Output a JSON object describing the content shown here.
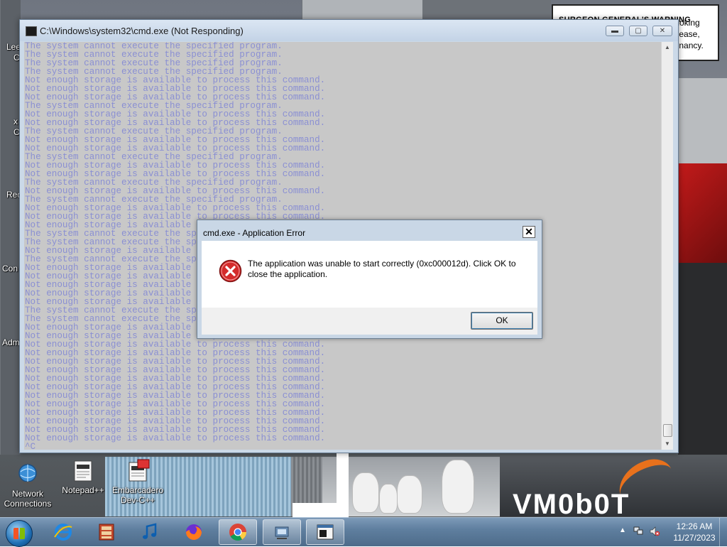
{
  "cmd_window": {
    "title": "C:\\Windows\\system32\\cmd.exe (Not Responding)",
    "min_glyph": "▬",
    "max_glyph": "▢",
    "close_glyph": "✕",
    "text_color": "#8a8fd3",
    "lines": [
      "The system cannot execute the specified program.",
      "The system cannot execute the specified program.",
      "The system cannot execute the specified program.",
      "The system cannot execute the specified program.",
      "Not enough storage is available to process this command.",
      "Not enough storage is available to process this command.",
      "Not enough storage is available to process this command.",
      "The system cannot execute the specified program.",
      "Not enough storage is available to process this command.",
      "Not enough storage is available to process this command.",
      "The system cannot execute the specified program.",
      "Not enough storage is available to process this command.",
      "Not enough storage is available to process this command.",
      "The system cannot execute the specified program.",
      "Not enough storage is available to process this command.",
      "Not enough storage is available to process this command.",
      "The system cannot execute the specified program.",
      "Not enough storage is available to process this command.",
      "The system cannot execute the specified program.",
      "Not enough storage is available to process this command.",
      "Not enough storage is available to process this command.",
      "Not enough storage is available to process this command.",
      "The system cannot execute the specified program.",
      "The system cannot execute the specified program.",
      "Not enough storage is available to process this command.",
      "The system cannot execute the specified program.",
      "Not enough storage is available to process this command.",
      "Not enough storage is available to process this command.",
      "Not enough storage is available to process this command.",
      "Not enough storage is available to process this command.",
      "Not enough storage is available to process this command.",
      "The system cannot execute the specified program.",
      "The system cannot execute the specified program.",
      "Not enough storage is available to process this command.",
      "Not enough storage is available to process this command.",
      "Not enough storage is available to process this command.",
      "Not enough storage is available to process this command.",
      "Not enough storage is available to process this command.",
      "Not enough storage is available to process this command.",
      "Not enough storage is available to process this command.",
      "Not enough storage is available to process this command.",
      "Not enough storage is available to process this command.",
      "Not enough storage is available to process this command.",
      "Not enough storage is available to process this command.",
      "Not enough storage is available to process this command.",
      "Not enough storage is available to process this command.",
      "Not enough storage is available to process this command.",
      "^C"
    ]
  },
  "error_dialog": {
    "title": "cmd.exe - Application Error",
    "close_glyph": "✕",
    "message": "The application was unable to start correctly (0xc000012d). Click OK to close the application.",
    "ok_label": "OK",
    "icon": "error-x-icon"
  },
  "desktop": {
    "icons": [
      {
        "label": "Network Connections",
        "icon": "network-globe-icon"
      },
      {
        "label": "Notepad++",
        "icon": "notepad-plus-plus-icon"
      },
      {
        "label": "Embarcadero Dev-C++",
        "icon": "devcpp-icon"
      }
    ],
    "left_labels": [
      "Lee",
      "C",
      "x",
      "C",
      "Rec",
      "Con",
      "Adm"
    ],
    "warning_label": {
      "heading": "SURGEON GENERAL'S WARNING",
      "text": "Smoking\nDisease,\nregnancy."
    },
    "watermark": "VM0b0T"
  },
  "taskbar": {
    "start": "windows-start-orb",
    "apps": [
      {
        "name": "internet-explorer-icon",
        "active": false
      },
      {
        "name": "app-shelf-icon",
        "active": false
      },
      {
        "name": "music-note-icon",
        "active": false
      },
      {
        "name": "firefox-icon",
        "active": false
      },
      {
        "name": "chrome-icon",
        "active": false
      },
      {
        "name": "device-manager-icon",
        "active": false
      },
      {
        "name": "cmd-window-icon",
        "active": true
      }
    ],
    "clock_time": "12:26 AM",
    "clock_date": "11/27/2023",
    "tray_arrow": "▲"
  },
  "colors": {
    "cmd_background": "#c8c8c8",
    "error_red": "#d42b2b",
    "titlebar": "#c3d3e6"
  }
}
